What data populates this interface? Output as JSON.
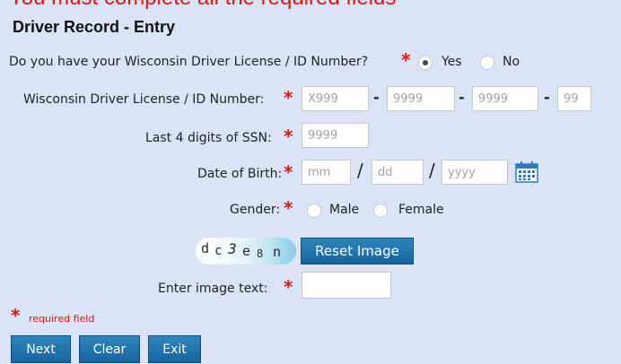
{
  "banner": {
    "text": "You must complete all the required fields"
  },
  "page_title": "Driver Record - Entry",
  "license_question": {
    "label": "Do you have your Wisconsin Driver License / ID Number?",
    "options": [
      {
        "label": "Yes",
        "selected": true
      },
      {
        "label": "No",
        "selected": false
      }
    ]
  },
  "license_number": {
    "label": "Wisconsin Driver License / ID Number:",
    "placeholders": [
      "X999",
      "9999",
      "9999",
      "99"
    ],
    "separators": [
      "-",
      "-",
      "-"
    ]
  },
  "ssn": {
    "label": "Last 4 digits of SSN:",
    "placeholder": "9999"
  },
  "dob": {
    "label": "Date of Birth:",
    "placeholders": {
      "month": "mm",
      "day": "dd",
      "year": "yyyy"
    },
    "separators": [
      "/",
      "/"
    ],
    "icon": "calendar-icon"
  },
  "gender": {
    "label": "Gender:",
    "options": [
      {
        "label": "Male",
        "selected": false
      },
      {
        "label": "Female",
        "selected": false
      }
    ]
  },
  "captcha": {
    "chars": [
      "d",
      "c",
      "3",
      "e",
      "8",
      "n"
    ],
    "reset_label": "Reset Image",
    "input_label": "Enter image text:",
    "value": ""
  },
  "required_marker": "*",
  "required_note": "required field",
  "buttons": {
    "next": "Next",
    "clear": "Clear",
    "exit": "Exit"
  },
  "colors": {
    "background": "#dbe3f7",
    "required": "#e8150c",
    "button": "#1e74ad"
  }
}
